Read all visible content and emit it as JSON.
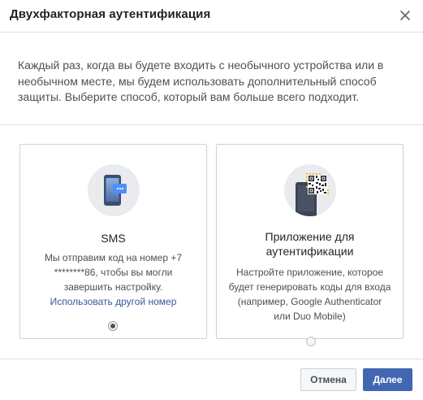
{
  "dialog": {
    "title": "Двухфакторная аутентификация",
    "description": "Каждый раз, когда вы будете входить с необычного устройства или в необычном месте, мы будем использовать дополнительный способ защиты. Выберите способ, который вам больше всего подходит."
  },
  "options": {
    "sms": {
      "title": "SMS",
      "text": "Мы отправим код на номер +7 ********86, чтобы вы могли завершить настройку.",
      "link": "Использовать другой номер",
      "selected": true,
      "icon": "phone-sms-icon"
    },
    "app": {
      "title": "Приложение для аутентификации",
      "text": "Настройте приложение, которое будет генерировать коды для входа (например, Google Authenticator или Duo Mobile)",
      "selected": false,
      "icon": "qr-phone-icon"
    }
  },
  "footer": {
    "cancel_label": "Отмена",
    "next_label": "Далее"
  },
  "colors": {
    "primary": "#4267b2",
    "link": "#365899",
    "border": "#dddfe2"
  }
}
